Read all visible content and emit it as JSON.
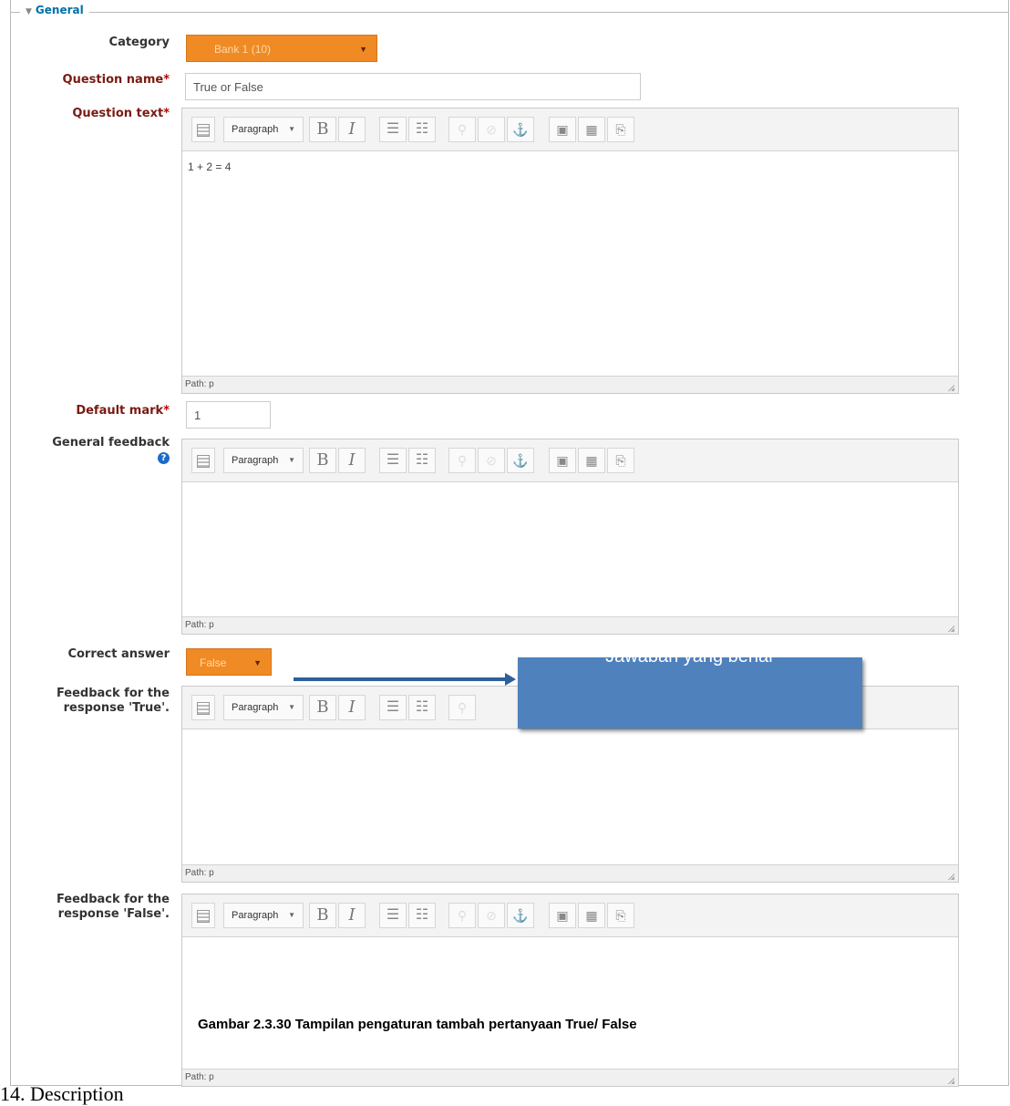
{
  "section": {
    "legend": "General"
  },
  "labels": {
    "category": "Category",
    "question_name": "Question name",
    "question_text": "Question text",
    "default_mark": "Default mark",
    "general_feedback": "General feedback",
    "correct_answer": "Correct answer",
    "feedback_true_line1": "Feedback for the",
    "feedback_true_line2": "response 'True'.",
    "feedback_false_line1": "Feedback for the",
    "feedback_false_line2": "response 'False'.",
    "required_mark": "*"
  },
  "fields": {
    "category_value": "Bank 1 (10)",
    "question_name_value": "True or False",
    "default_mark_value": "1",
    "correct_answer_value": "False"
  },
  "editor": {
    "paragraph_label": "Paragraph",
    "bold": "B",
    "italic": "I",
    "path_label": "Path: p",
    "question_text_content": "1 + 2 = 4"
  },
  "icons": {
    "grid": "toolbar-toggle-icon",
    "ul": "bullet-list-icon",
    "ol": "numbered-list-icon",
    "link": "link-icon",
    "unlink": "unlink-icon",
    "anchor": "anchor-icon",
    "image": "image-icon",
    "media": "media-icon",
    "paste": "paste-icon",
    "help": "help-icon"
  },
  "annotation": {
    "callout_text": "Jawaban yang benar"
  },
  "caption": "Gambar 2.3.30 Tampilan pengaturan tambah pertanyaan True/ False",
  "document_heading": "14. Description",
  "colors": {
    "select_orange": "#f08a24",
    "callout_blue": "#4f81bd",
    "legend_blue": "#0070a8",
    "required_red": "#7a1a12"
  }
}
